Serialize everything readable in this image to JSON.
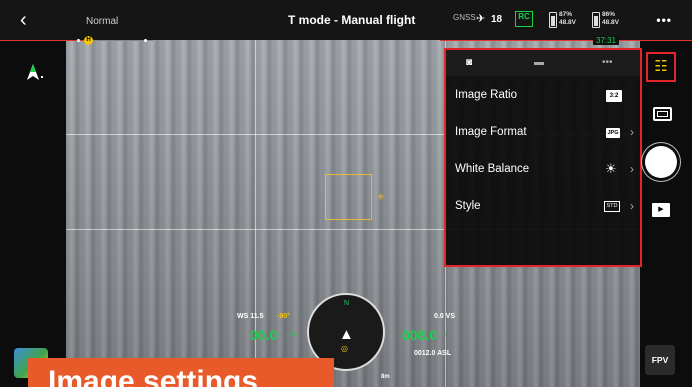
{
  "top_bar": {
    "back_icon": "back-chevron-icon",
    "mode": "Normal",
    "title": "T mode - Manual flight",
    "gps_label": "GNSS",
    "satellite_icon": "satellite-icon",
    "satellite_count": "18",
    "rc_label": "RC",
    "battery_1_percent": "87%",
    "battery_1_voltage": "48.8V",
    "battery_2_percent": "86%",
    "battery_2_voltage": "48.8V",
    "more_icon": "•••",
    "timer": "37:31",
    "home_marker": "H"
  },
  "camera_settings": {
    "tabs": [
      {
        "icon": "camera-icon",
        "glyph": "◙",
        "active": true
      },
      {
        "icon": "video-icon",
        "glyph": "▬",
        "active": false
      },
      {
        "icon": "more-icon",
        "glyph": "•••",
        "active": false
      }
    ],
    "items": [
      {
        "label": "Image Ratio",
        "value": "3:2"
      },
      {
        "label": "Image Format",
        "value": "JPG"
      },
      {
        "label": "White Balance",
        "value_icon": "sun-icon",
        "value_glyph": "☀"
      },
      {
        "label": "Style",
        "value": "STD"
      }
    ]
  },
  "right_controls": {
    "settings_icon": "sliders-icon",
    "settings_glyph": "☷",
    "playback_glyph": "▶",
    "fpv_label": "FPV"
  },
  "telemetry": {
    "ws_label": "WS 11.5",
    "gimbal_angle": "-90°",
    "horizontal_speed": "00.0",
    "horizontal_speed_unit": "m/s",
    "vs_label": "0.0 VS",
    "altitude": "008.0",
    "altitude_unit": "m",
    "asl_label": "0012.0 ASL",
    "north_label": "N",
    "home_distance": "8m"
  },
  "caption": "Image settings",
  "colors": {
    "accent_red": "#e3262c",
    "accent_green": "#19d24a",
    "accent_yellow": "#f2c500",
    "caption_orange": "#e85a2a"
  }
}
